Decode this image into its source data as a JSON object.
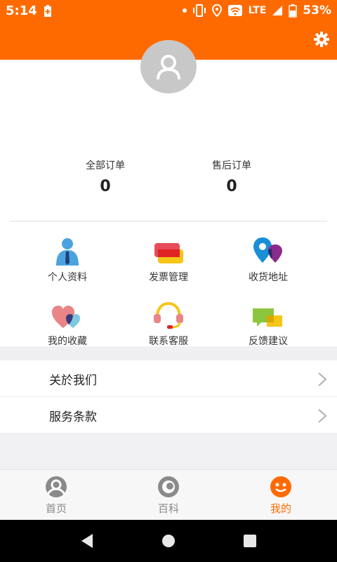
{
  "status_bar": {
    "time": "5:14",
    "network": "LTE",
    "battery": "53%"
  },
  "header": {
    "settings_icon": "gear-icon"
  },
  "profile": {
    "avatar_icon": "user-avatar-icon"
  },
  "orders": [
    {
      "label": "全部订单",
      "count": "0"
    },
    {
      "label": "售后订单",
      "count": "0"
    }
  ],
  "grid": [
    {
      "label": "个人资料",
      "icon": "profile-person-icon"
    },
    {
      "label": "发票管理",
      "icon": "invoice-cards-icon"
    },
    {
      "label": "收货地址",
      "icon": "location-pin-icon"
    },
    {
      "label": "我的收藏",
      "icon": "hearts-icon"
    },
    {
      "label": "联系客服",
      "icon": "headset-icon"
    },
    {
      "label": "反馈建议",
      "icon": "chat-bubbles-icon"
    }
  ],
  "menu": [
    {
      "label": "关於我们"
    },
    {
      "label": "服务条款"
    }
  ],
  "bottom_nav": [
    {
      "label": "首页",
      "active": false
    },
    {
      "label": "百科",
      "active": false
    },
    {
      "label": "我的",
      "active": true
    }
  ],
  "colors": {
    "accent": "#ff6a00"
  }
}
